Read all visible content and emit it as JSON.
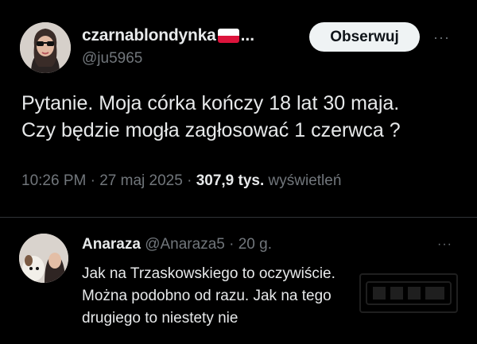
{
  "tweet": {
    "display_name": "czarnablondynka",
    "name_truncation": "...",
    "handle": "@ju5965",
    "follow_label": "Obserwuj",
    "more_label": "···",
    "text_lines": [
      "Pytanie. Moja córka kończy 18 lat 30 maja.",
      "Czy będzie mogła zagłosować 1 czerwca ?"
    ],
    "time": "10:26 PM",
    "date": "27 maj 2025",
    "separator": "·",
    "views_count": "307,9 tys.",
    "views_label": "wyświetleń",
    "flag": "poland-flag"
  },
  "reply": {
    "display_name": "Anaraza",
    "handle": "@Anaraza5",
    "separator": "·",
    "age": "20 g.",
    "more_label": "···",
    "text_lines": [
      "Jak na Trzaskowskiego to oczywiście.",
      "Można podobno od razu. Jak na tego",
      "drugiego to niestety nie"
    ]
  },
  "colors": {
    "background": "#000000",
    "text": "#e7e9ea",
    "muted": "#71767b",
    "divider": "#2f3336",
    "follow_bg": "#eff3f4"
  }
}
